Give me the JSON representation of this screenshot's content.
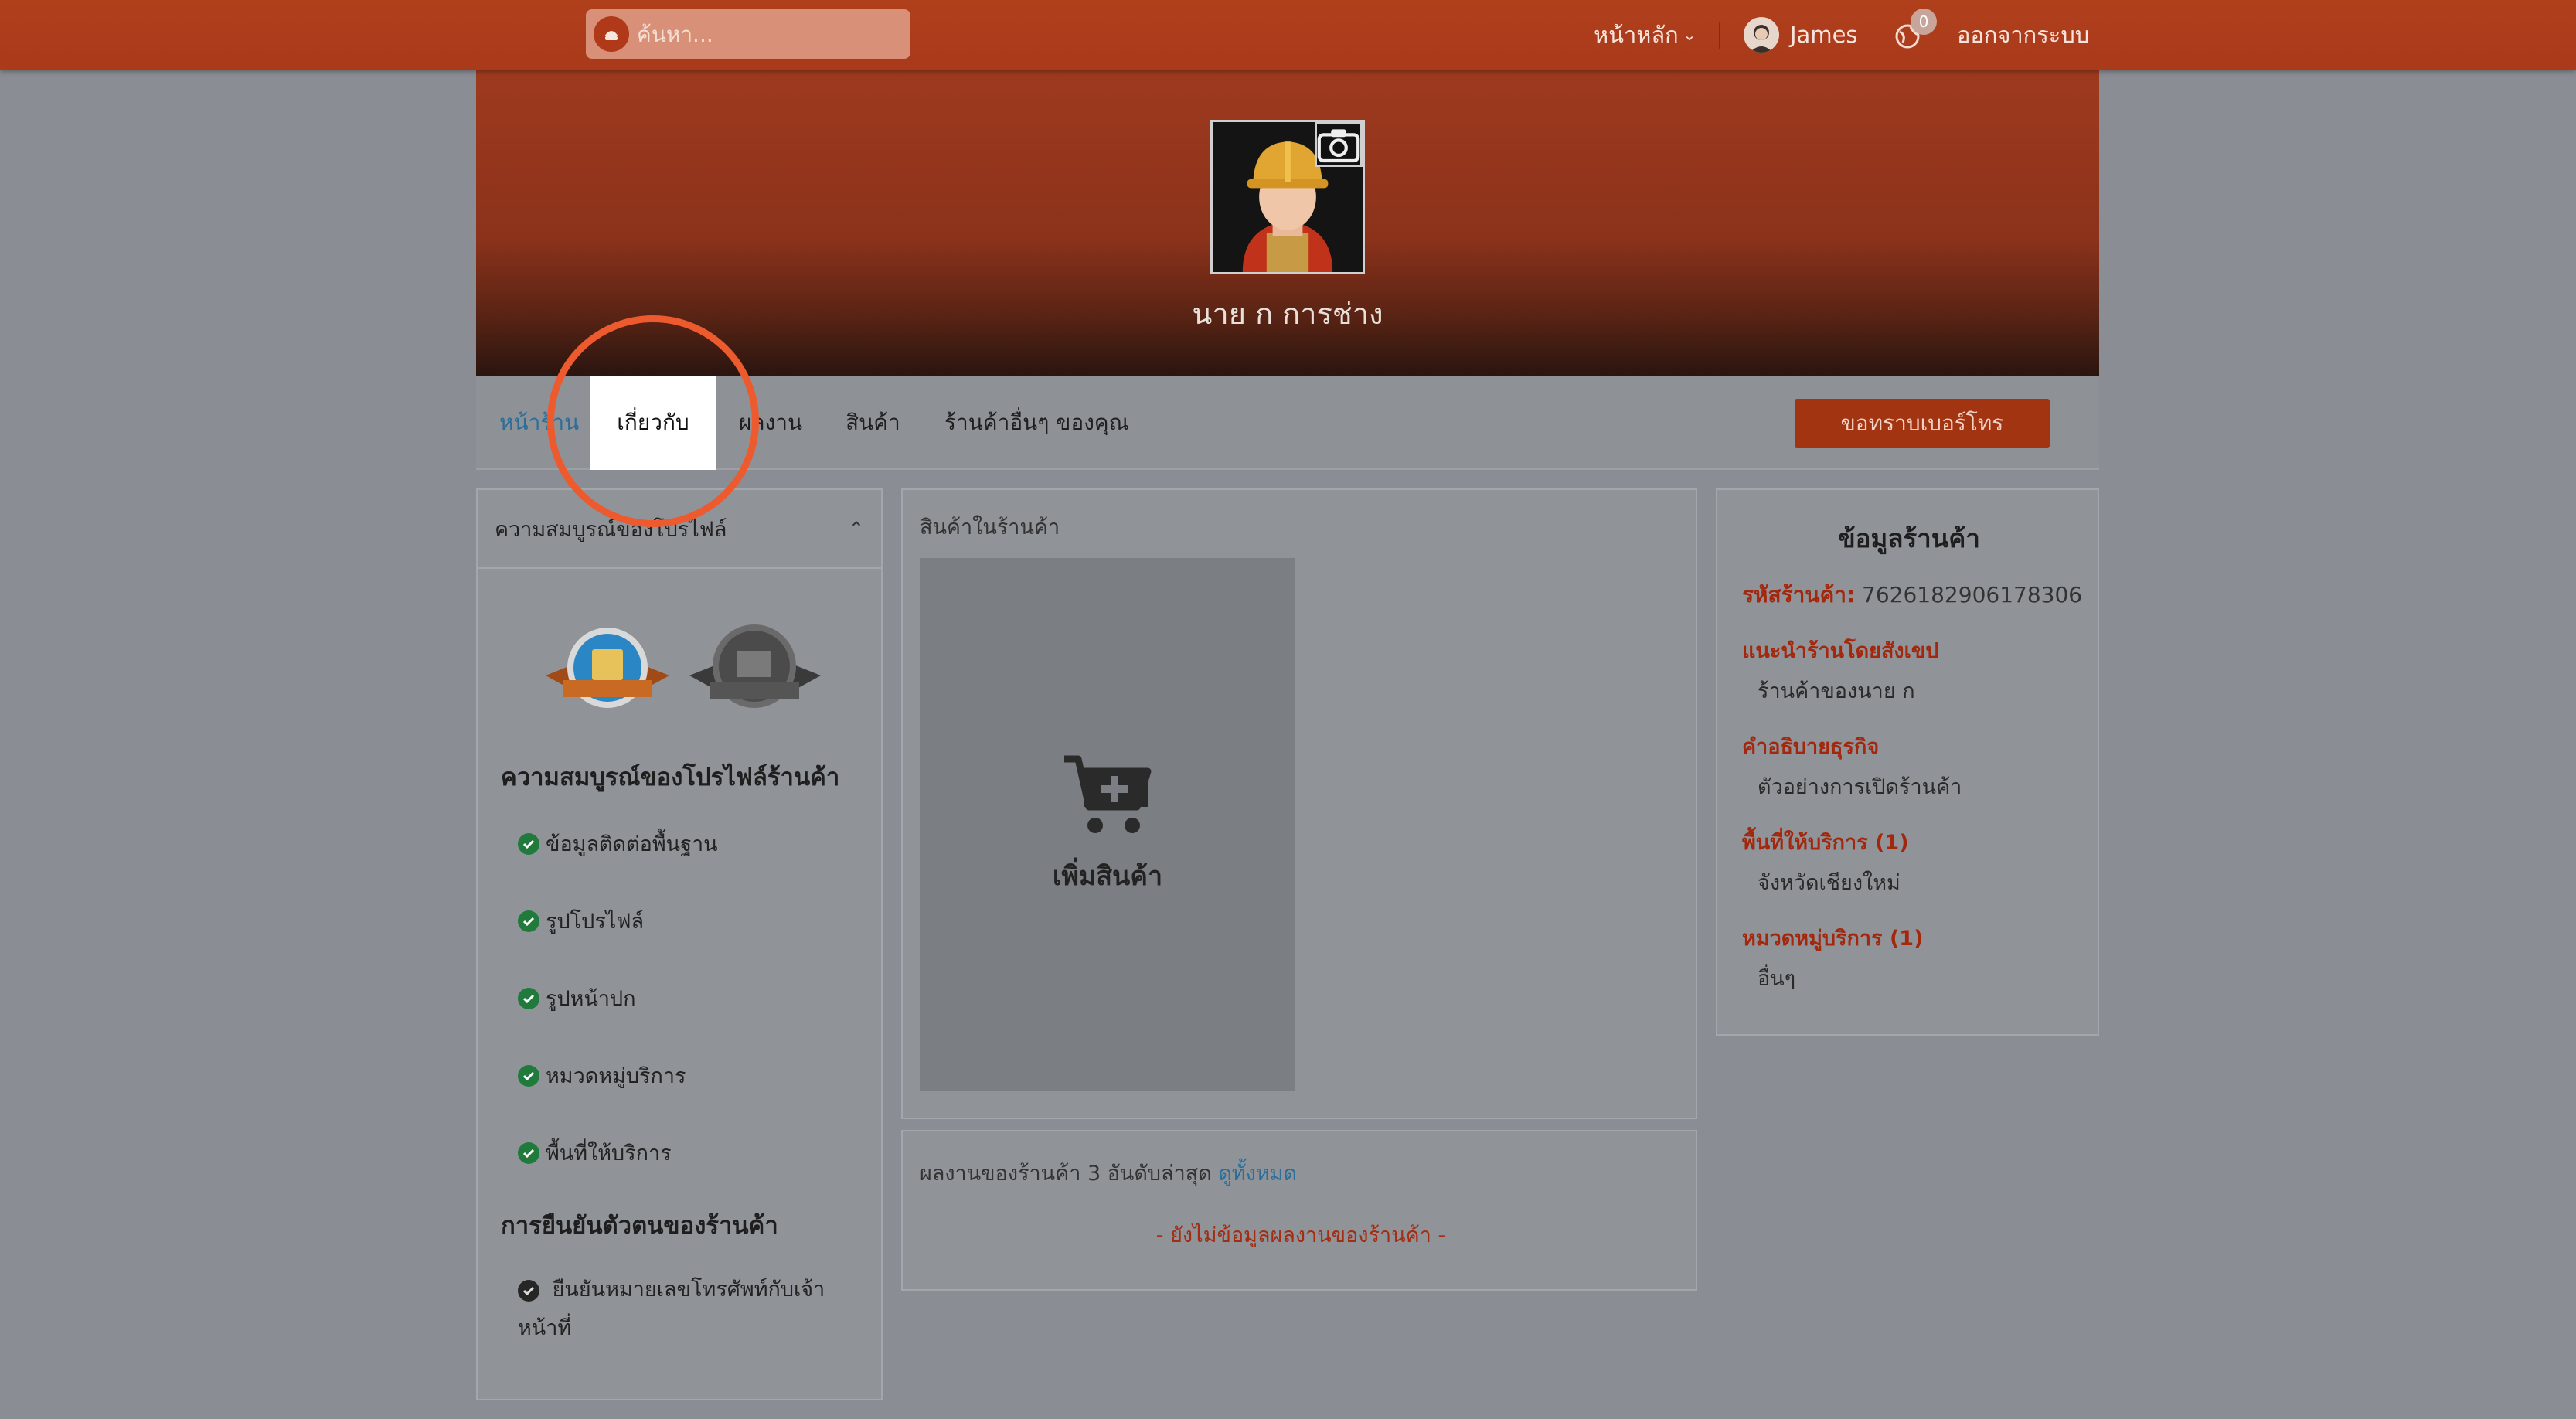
{
  "navbar": {
    "search_placeholder": "ค้นหา...",
    "home_label": "หน้าหลัก",
    "user_name": "James",
    "notification_count": "0",
    "logout_label": "ออกจากระบบ"
  },
  "cover": {
    "shop_name": "นาย ก การช่าง"
  },
  "tabs": [
    {
      "label": "หน้าร้าน"
    },
    {
      "label": "เกี่ยวกับ"
    },
    {
      "label": "ผลงาน"
    },
    {
      "label": "สินค้า"
    },
    {
      "label": "ร้านค้าอื่นๆ ของคุณ"
    }
  ],
  "phone_button": "ขอทราบเบอร์โทร",
  "profile_completeness": {
    "header": "ความสมบูรณ์ของโปรไฟล์",
    "shop_title": "ความสมบูรณ์ของโปรไฟล์ร้านค้า",
    "items": [
      "ข้อมูลติดต่อพื้นฐาน",
      "รูปโปรไฟล์",
      "รูปหน้าปก",
      "หมวดหมู่บริการ",
      "พื้นที่ให้บริการ"
    ],
    "verify_title": "การยืนยันตัวตนของร้านค้า",
    "verify_item_line1": "ยืนยันหมายเลขโทรศัพท์กับเจ้า",
    "verify_item_line2": "หน้าที่"
  },
  "products": {
    "title": "สินค้าในร้านค้า",
    "add_label": "เพิ่มสินค้า"
  },
  "works": {
    "title": "ผลงานของร้านค้า 3 อันดับล่าสุด",
    "view_all": "ดูทั้งหมด",
    "empty": "- ยังไม่ข้อมูลผลงานของร้านค้า -"
  },
  "shop_info": {
    "title": "ข้อมูลร้านค้า",
    "id_label": "รหัสร้านค้า:",
    "id_value": "7626182906178306",
    "intro_label": "แนะนำร้านโดยสังเขป",
    "intro_value": "ร้านค้าของนาย ก",
    "desc_label": "คำอธิบายธุรกิจ",
    "desc_value": "ตัวอย่างการเปิดร้านค้า",
    "area_label": "พื้นที่ให้บริการ (1)",
    "area_value": "จังหวัดเชียงใหม่",
    "category_label": "หมวดหมู่บริการ (1)",
    "category_value": "อื่นๆ"
  }
}
